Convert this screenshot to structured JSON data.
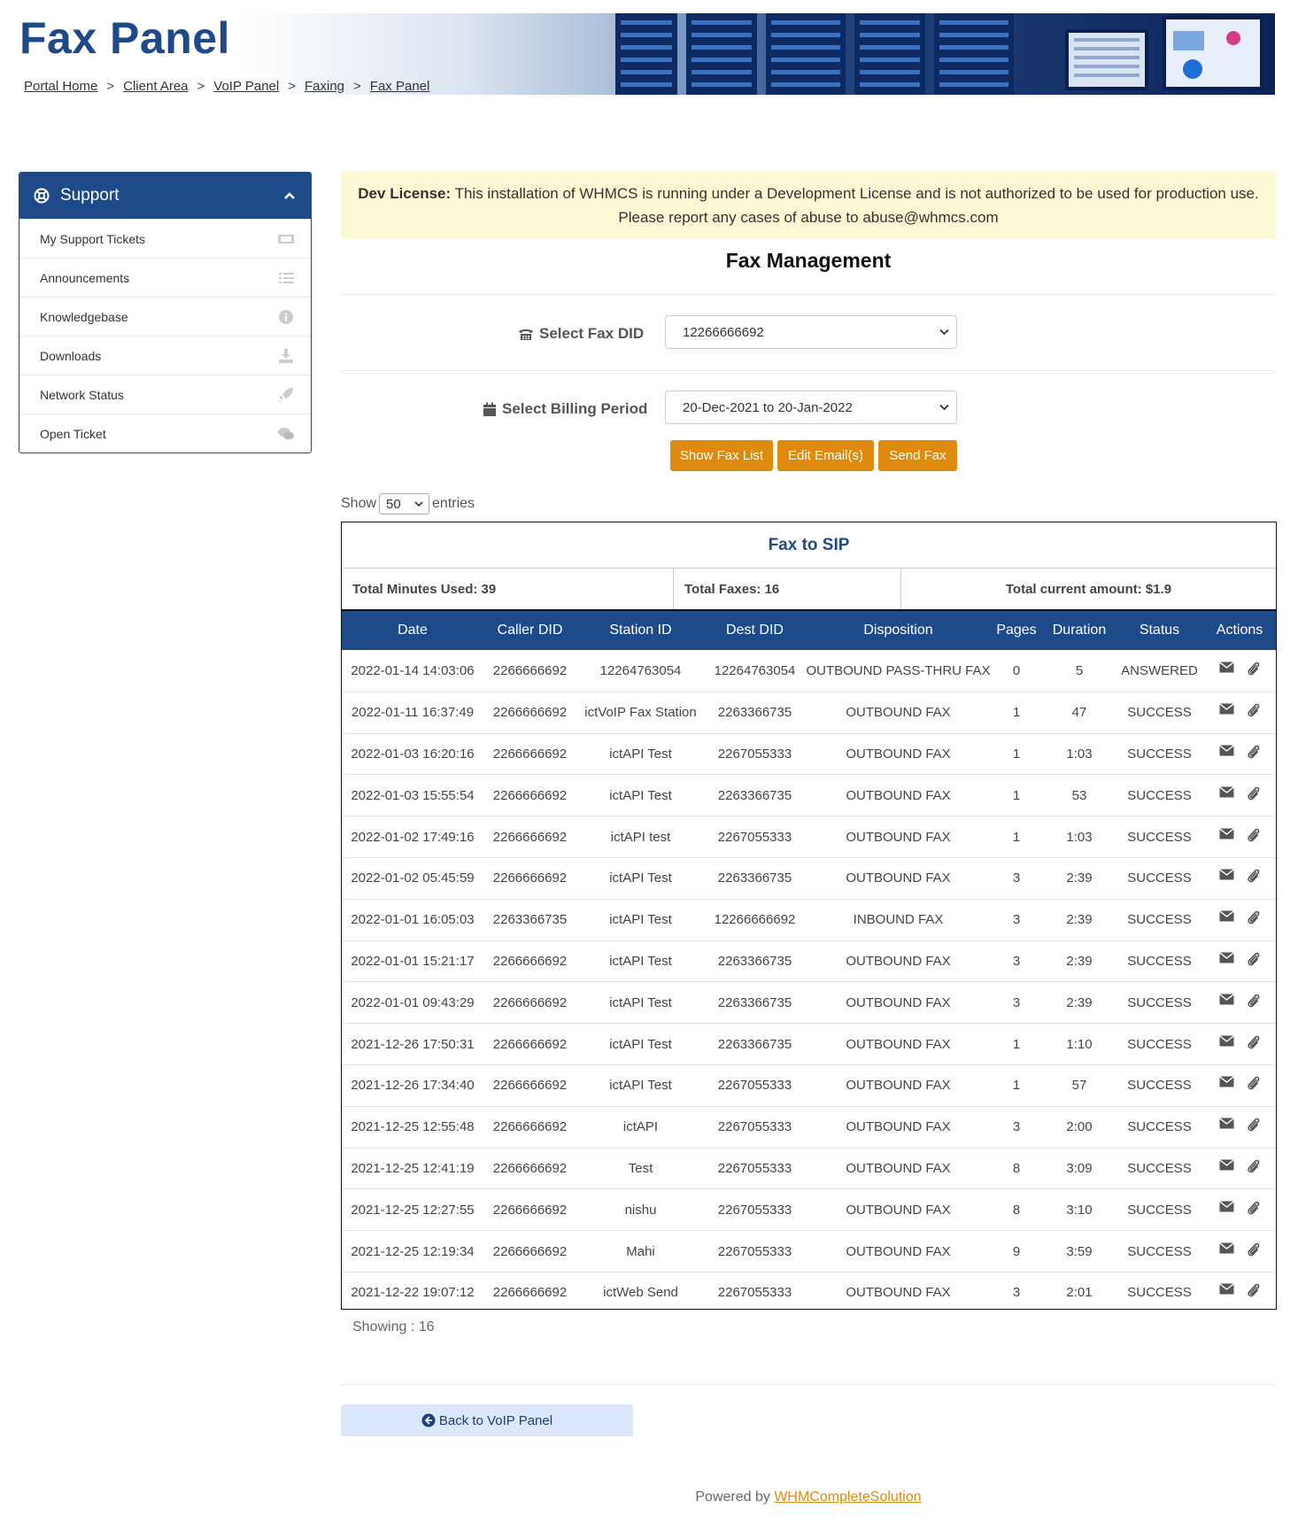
{
  "header": {
    "title": "Fax Panel",
    "breadcrumbs": [
      "Portal Home",
      "Client Area",
      "VoIP Panel",
      "Faxing",
      "Fax Panel"
    ],
    "breadcrumb_separator": ">"
  },
  "sidebar": {
    "title": "Support",
    "items": [
      {
        "label": "My Support Tickets",
        "icon": "ticket-icon"
      },
      {
        "label": "Announcements",
        "icon": "list-icon"
      },
      {
        "label": "Knowledgebase",
        "icon": "info-icon"
      },
      {
        "label": "Downloads",
        "icon": "download-icon"
      },
      {
        "label": "Network Status",
        "icon": "rocket-icon"
      },
      {
        "label": "Open Ticket",
        "icon": "comments-icon"
      }
    ]
  },
  "alert": {
    "label": "Dev License:",
    "text": "This installation of WHMCS is running under a Development License and is not authorized to be used for production use. Please report any cases of abuse to abuse@whmcs.com"
  },
  "fax_management": {
    "title": "Fax Management",
    "fax_did_label": "Select Fax DID",
    "fax_did_value": "12266666692",
    "billing_label": "Select Billing Period",
    "billing_value": "20-Dec-2021 to 20-Jan-2022",
    "buttons": {
      "show_fax_list": "Show Fax List",
      "edit_emails": "Edit Email(s)",
      "send_fax": "Send Fax"
    }
  },
  "entries": {
    "prefix": "Show",
    "value": "50",
    "suffix": "entries"
  },
  "table": {
    "title": "Fax to SIP",
    "total_minutes": "Total Minutes Used: 39",
    "total_faxes": "Total Faxes: 16",
    "total_amount": "Total current amount: $1.9",
    "columns": [
      "Date",
      "Caller DID",
      "Station ID",
      "Dest DID",
      "Disposition",
      "Pages",
      "Duration",
      "Status",
      "Actions"
    ],
    "rows": [
      [
        "2022-01-14 14:03:06",
        "2266666692",
        "12264763054",
        "12264763054",
        "OUTBOUND PASS-THRU FAX",
        "0",
        "5",
        "ANSWERED"
      ],
      [
        "2022-01-11 16:37:49",
        "2266666692",
        "ictVoIP Fax Station",
        "2263366735",
        "OUTBOUND FAX",
        "1",
        "47",
        "SUCCESS"
      ],
      [
        "2022-01-03 16:20:16",
        "2266666692",
        "ictAPI Test",
        "2267055333",
        "OUTBOUND FAX",
        "1",
        "1:03",
        "SUCCESS"
      ],
      [
        "2022-01-03 15:55:54",
        "2266666692",
        "ictAPI Test",
        "2263366735",
        "OUTBOUND FAX",
        "1",
        "53",
        "SUCCESS"
      ],
      [
        "2022-01-02 17:49:16",
        "2266666692",
        "ictAPI test",
        "2267055333",
        "OUTBOUND FAX",
        "1",
        "1:03",
        "SUCCESS"
      ],
      [
        "2022-01-02 05:45:59",
        "2266666692",
        "ictAPI Test",
        "2263366735",
        "OUTBOUND FAX",
        "3",
        "2:39",
        "SUCCESS"
      ],
      [
        "2022-01-01 16:05:03",
        "2263366735",
        "ictAPI Test",
        "12266666692",
        "INBOUND FAX",
        "3",
        "2:39",
        "SUCCESS"
      ],
      [
        "2022-01-01 15:21:17",
        "2266666692",
        "ictAPI Test",
        "2263366735",
        "OUTBOUND FAX",
        "3",
        "2:39",
        "SUCCESS"
      ],
      [
        "2022-01-01 09:43:29",
        "2266666692",
        "ictAPI Test",
        "2263366735",
        "OUTBOUND FAX",
        "3",
        "2:39",
        "SUCCESS"
      ],
      [
        "2021-12-26 17:50:31",
        "2266666692",
        "ictAPI Test",
        "2263366735",
        "OUTBOUND FAX",
        "1",
        "1:10",
        "SUCCESS"
      ],
      [
        "2021-12-26 17:34:40",
        "2266666692",
        "ictAPI Test",
        "2267055333",
        "OUTBOUND FAX",
        "1",
        "57",
        "SUCCESS"
      ],
      [
        "2021-12-25 12:55:48",
        "2266666692",
        "ictAPI",
        "2267055333",
        "OUTBOUND FAX",
        "3",
        "2:00",
        "SUCCESS"
      ],
      [
        "2021-12-25 12:41:19",
        "2266666692",
        "Test",
        "2267055333",
        "OUTBOUND FAX",
        "8",
        "3:09",
        "SUCCESS"
      ],
      [
        "2021-12-25 12:27:55",
        "2266666692",
        "nishu",
        "2267055333",
        "OUTBOUND FAX",
        "8",
        "3:10",
        "SUCCESS"
      ],
      [
        "2021-12-25 12:19:34",
        "2266666692",
        "Mahi",
        "2267055333",
        "OUTBOUND FAX",
        "9",
        "3:59",
        "SUCCESS"
      ],
      [
        "2021-12-22 19:07:12",
        "2266666692",
        "ictWeb Send",
        "2267055333",
        "OUTBOUND FAX",
        "3",
        "2:01",
        "SUCCESS"
      ]
    ]
  },
  "showing": "Showing : 16",
  "back_button": "Back to VoIP Panel",
  "footer": {
    "prefix": "Powered by",
    "link": "WHMCompleteSolution"
  },
  "colors": {
    "brand_blue": "#1f4a8a",
    "accent_orange": "#dd8a0e",
    "alert_bg": "#fcf8d3"
  }
}
